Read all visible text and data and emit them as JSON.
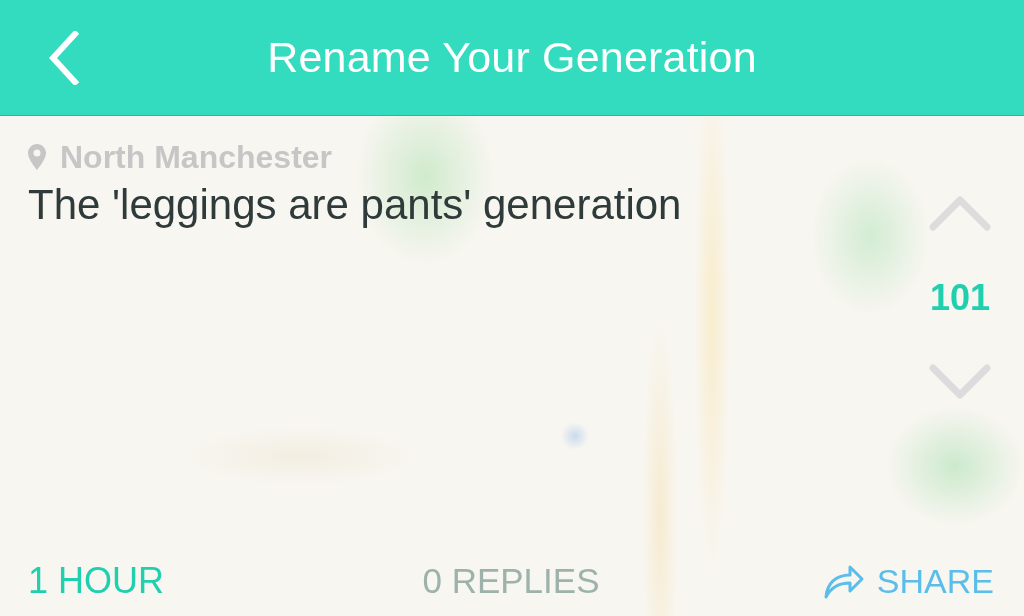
{
  "header": {
    "title": "Rename Your Generation"
  },
  "post": {
    "location": "North Manchester",
    "message": "The 'leggings are pants' generation",
    "votes": {
      "count": "101"
    }
  },
  "footer": {
    "age": "1 HOUR",
    "replies": "0 REPLIES",
    "share": "SHARE"
  }
}
